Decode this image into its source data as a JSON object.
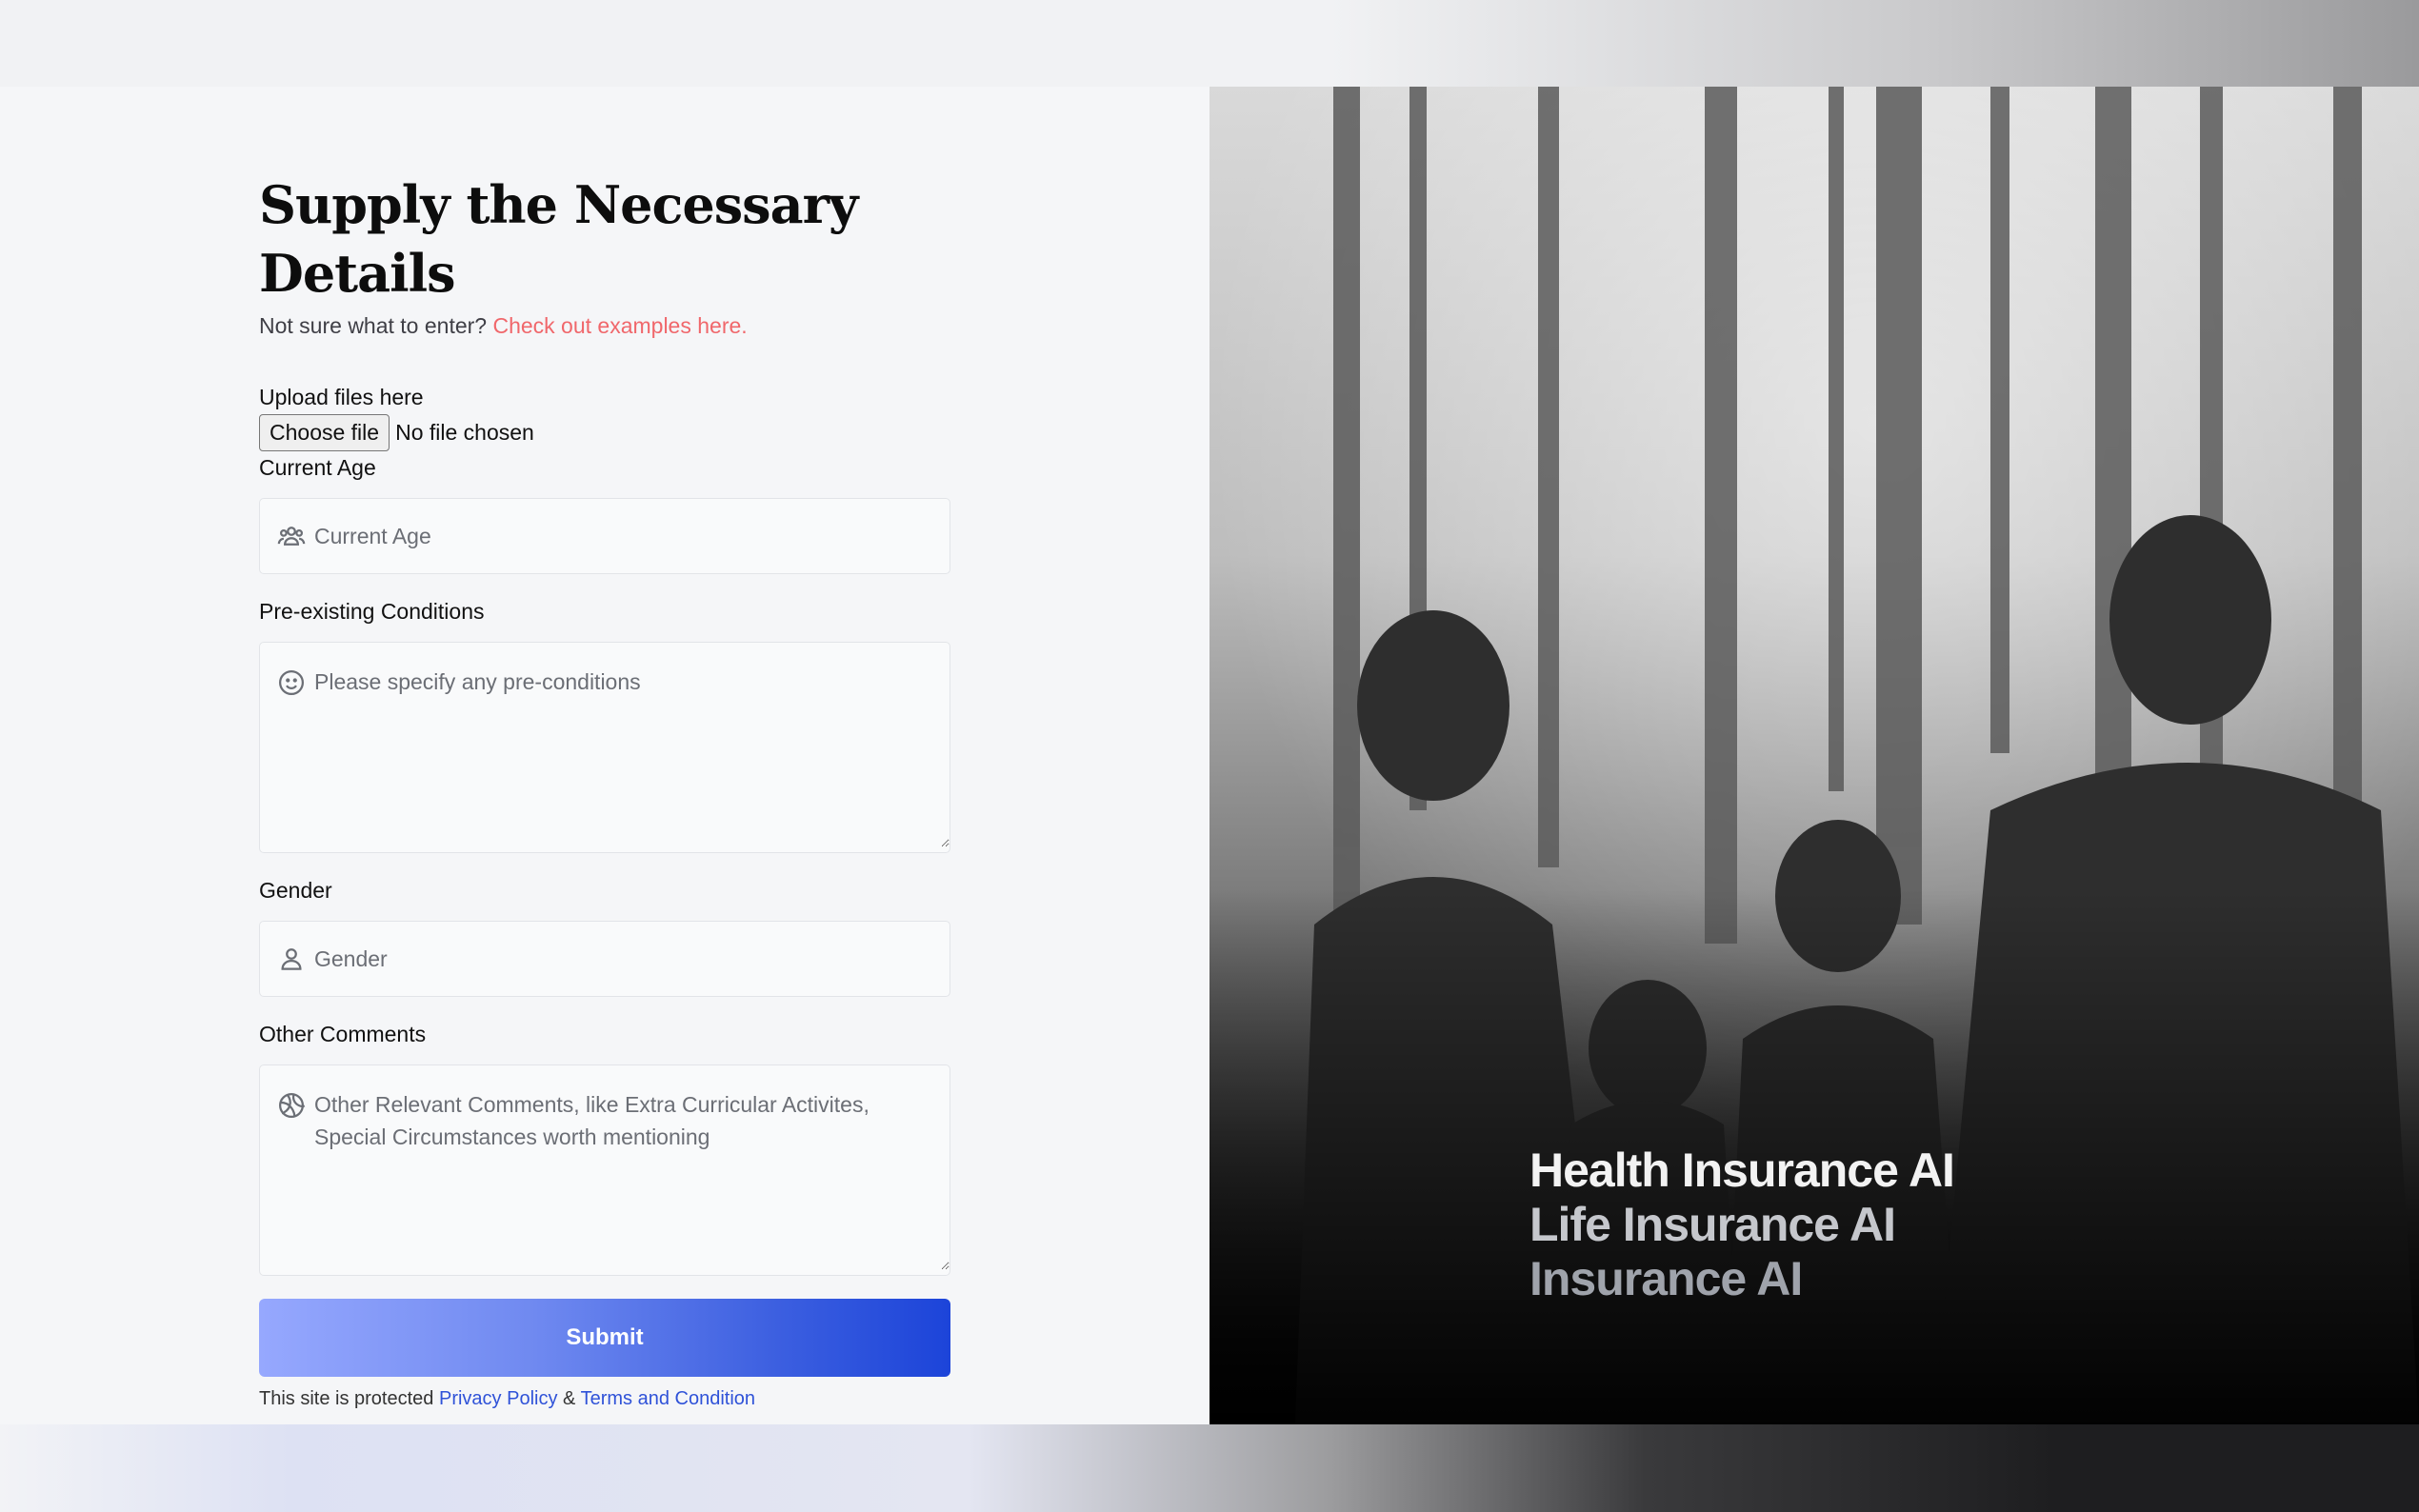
{
  "form": {
    "title": "Supply the Necessary Details",
    "subtitle_prefix": "Not sure what to enter?",
    "subtitle_link": "Check out examples here.",
    "upload": {
      "label": "Upload files here",
      "button": "Choose file",
      "status": "No file chosen"
    },
    "age": {
      "label": "Current Age",
      "placeholder": "Current Age",
      "icon": "users-icon"
    },
    "conditions": {
      "label": "Pre-existing Conditions",
      "placeholder": "Please specify any pre-conditions",
      "icon": "smiley-icon"
    },
    "gender": {
      "label": "Gender",
      "placeholder": "Gender",
      "icon": "user-icon"
    },
    "comments": {
      "label": "Other Comments",
      "placeholder": "Other Relevant Comments, like Extra Curricular Activites, Special Circumstances worth mentioning",
      "icon": "basketball-icon"
    },
    "submit": "Submit",
    "legal": {
      "prefix": "This site is protected",
      "privacy": "Privacy Policy",
      "amp": "&",
      "terms": "Terms and Condition"
    }
  },
  "hero": {
    "lines": [
      "Health Insurance AI",
      "Life Insurance AI",
      "Insurance AI"
    ]
  },
  "colors": {
    "link_red": "#f0676b",
    "link_blue": "#2f52d8",
    "submit_start": "#96a8fe",
    "submit_end": "#1c44d9"
  }
}
